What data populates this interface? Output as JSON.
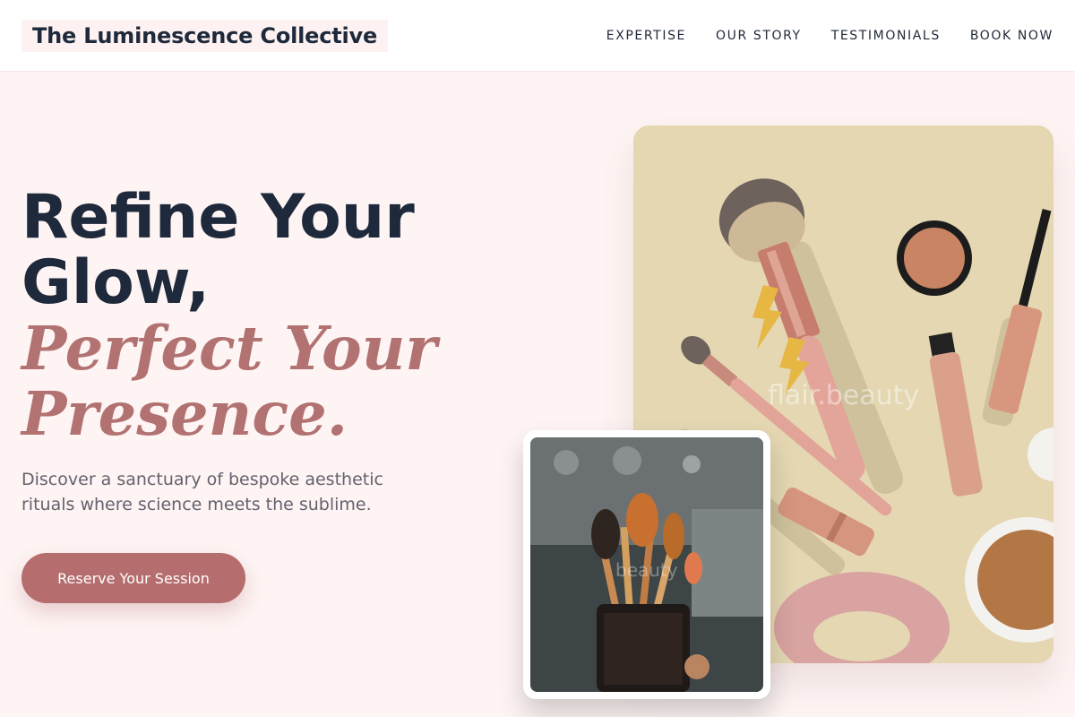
{
  "brand": {
    "name": "The Luminescence Collective"
  },
  "nav": {
    "items": [
      "EXPERTISE",
      "OUR STORY",
      "TESTIMONIALS",
      "BOOK NOW"
    ]
  },
  "hero": {
    "headline_line1": "Refine Your",
    "headline_line2": "Glow,",
    "headline_italic_line1": "Perfect Your",
    "headline_italic_line2": "Presence.",
    "subtext": "Discover a sanctuary of bespoke aesthetic rituals where science meets the sublime.",
    "cta_label": "Reserve Your Session"
  },
  "images": {
    "main_watermark": "flair.beauty",
    "thumb_watermark": "beauty"
  },
  "colors": {
    "background": "#fdf4f3",
    "accent": "#b56d6d",
    "italic_text": "#b27272",
    "heading": "#1e293b",
    "product_tan": "#e4d7b2"
  }
}
